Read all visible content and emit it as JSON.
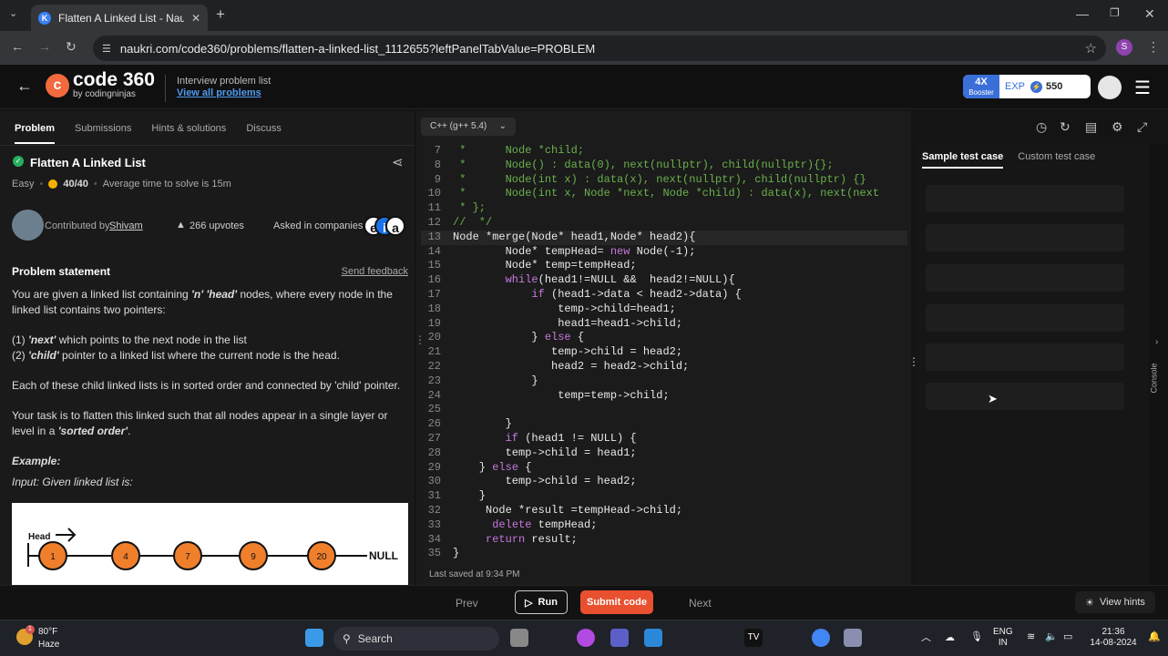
{
  "browser": {
    "tab_title": "Flatten A Linked List - Naukri C",
    "favicon_text": "K",
    "url": "naukri.com/code360/problems/flatten-a-linked-list_1112655?leftPanelTabValue=PROBLEM",
    "profile_initial": "S"
  },
  "header": {
    "logo_text": "code 360",
    "logo_sub": "by codingninjas",
    "interview_text": "Interview problem list",
    "view_all": "View all problems",
    "booster_main": "4X",
    "booster_sub": "Booster",
    "exp_label": "EXP",
    "exp_value": "550"
  },
  "left": {
    "tabs": [
      "Problem",
      "Submissions",
      "Hints & solutions",
      "Discuss"
    ],
    "title": "Flatten A Linked List",
    "difficulty": "Easy",
    "score": "40/40",
    "avg_time": "Average time to solve is 15m",
    "contributed_by": "Contributed by",
    "contributor": "Shivam",
    "upvotes": "266 upvotes",
    "asked_in": "Asked in companies",
    "statement_heading": "Problem statement",
    "send_feedback": "Send feedback",
    "p1_a": "You are given a linked list containing ",
    "p1_b": "'n' 'head'",
    "p1_c": " nodes, where every node in the linked list contains two pointers:",
    "p2_a": "(1) ",
    "p2_b": "'next'",
    "p2_c": " which points to the next node in the list",
    "p3_a": "(2) ",
    "p3_b": "'child'",
    "p3_c": " pointer to a linked list where the current node is the head.",
    "p4": "Each of these child linked lists is in sorted order and connected by 'child' pointer.",
    "p5_a": "Your task is to flatten this linked such that all nodes appear in a single layer or level in a ",
    "p5_b": "'sorted order'",
    "p5_c": ".",
    "example": "Example:",
    "input_line": "Input: Given linked list is:",
    "diagram": {
      "head": "Head",
      "nodes": [
        "1",
        "4",
        "7",
        "9",
        "20"
      ],
      "null": "NULL"
    }
  },
  "editor": {
    "language": "C++ (g++ 5.4)",
    "last_saved": "Last saved at 9:34 PM",
    "lines": [
      {
        "n": "7",
        "t": " *      Node *child;"
      },
      {
        "n": "8",
        "t": " *      Node() : data(0), next(nullptr), child(nullptr){};"
      },
      {
        "n": "9",
        "t": " *      Node(int x) : data(x), next(nullptr), child(nullptr) {}"
      },
      {
        "n": "10",
        "t": " *      Node(int x, Node *next, Node *child) : data(x), next(next"
      },
      {
        "n": "11",
        "t": " * };"
      },
      {
        "n": "12",
        "t": "//  */"
      },
      {
        "n": "13",
        "t": "Node *merge(Node* head1,Node* head2){"
      },
      {
        "n": "14",
        "t": "        Node* tempHead= new Node(-1);"
      },
      {
        "n": "15",
        "t": "        Node* temp=tempHead;"
      },
      {
        "n": "16",
        "t": "        while(head1!=NULL &&  head2!=NULL){"
      },
      {
        "n": "17",
        "t": "            if (head1->data < head2->data) {"
      },
      {
        "n": "18",
        "t": "                temp->child=head1;"
      },
      {
        "n": "19",
        "t": "                head1=head1->child;"
      },
      {
        "n": "20",
        "t": "            } else {"
      },
      {
        "n": "21",
        "t": "               temp->child = head2;"
      },
      {
        "n": "22",
        "t": "               head2 = head2->child;"
      },
      {
        "n": "23",
        "t": "            }"
      },
      {
        "n": "24",
        "t": "                temp=temp->child;"
      },
      {
        "n": "25",
        "t": ""
      },
      {
        "n": "26",
        "t": "        }"
      },
      {
        "n": "27",
        "t": "        if (head1 != NULL) {"
      },
      {
        "n": "28",
        "t": "        temp->child = head1;"
      },
      {
        "n": "29",
        "t": "    } else {"
      },
      {
        "n": "30",
        "t": "        temp->child = head2;"
      },
      {
        "n": "31",
        "t": "    }"
      },
      {
        "n": "32",
        "t": "     Node *result =tempHead->child;"
      },
      {
        "n": "33",
        "t": "      delete tempHead;"
      },
      {
        "n": "34",
        "t": "     return result;"
      },
      {
        "n": "35",
        "t": "}"
      }
    ]
  },
  "right": {
    "tabs": [
      "Sample test case",
      "Custom test case"
    ],
    "console_label": "Console"
  },
  "bottom": {
    "prev": "Prev",
    "run": "Run",
    "submit": "Submit code",
    "next": "Next",
    "hints": "View hints"
  },
  "taskbar": {
    "weather_temp": "80°F",
    "weather_desc": "Haze",
    "weather_badge": "1",
    "search": "Search",
    "lang1": "ENG",
    "lang2": "IN",
    "time": "21:36",
    "date": "14-08-2024"
  }
}
